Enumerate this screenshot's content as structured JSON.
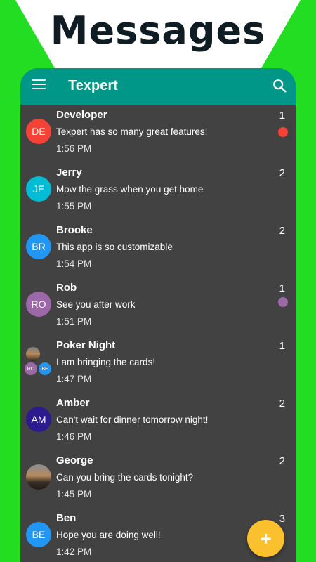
{
  "headline": "Messages",
  "colors": {
    "bg_green": "#22dd22",
    "appbar": "#009688",
    "list_bg": "#424242",
    "fab": "#fbc02d"
  },
  "appbar": {
    "title": "Texpert",
    "menu_icon": "hamburger-menu-icon",
    "search_icon": "search-icon"
  },
  "conversations": [
    {
      "name": "Developer",
      "preview": "Texpert has so many great features!",
      "time": "1:56 PM",
      "count": "1",
      "avatar_initials": "DE",
      "avatar_color": "#f44336",
      "unread_dot": "#f44336"
    },
    {
      "name": "Jerry",
      "preview": "Mow the grass when you get home",
      "time": "1:55 PM",
      "count": "2",
      "avatar_initials": "JE",
      "avatar_color": "#00bcd4"
    },
    {
      "name": "Brooke",
      "preview": "This app is so customizable",
      "time": "1:54 PM",
      "count": "2",
      "avatar_initials": "BR",
      "avatar_color": "#2196f3"
    },
    {
      "name": "Rob",
      "preview": "See you after work",
      "time": "1:51 PM",
      "count": "1",
      "avatar_initials": "RO",
      "avatar_color": "#9c68a8",
      "unread_dot": "#9c68a8"
    },
    {
      "name": "Poker Night",
      "preview": "I am bringing the cards!",
      "time": "1:47 PM",
      "count": "1",
      "group_members": [
        {
          "initials": "RO",
          "color": "#9c68a8"
        },
        {
          "initials": "BE",
          "color": "#2196f3"
        }
      ]
    },
    {
      "name": "Amber",
      "preview": "Can't wait for dinner tomorrow night!",
      "time": "1:46 PM",
      "count": "2",
      "avatar_initials": "AM",
      "avatar_color": "#2b1b8e"
    },
    {
      "name": "George",
      "preview": "Can you bring the cards tonight?",
      "time": "1:45 PM",
      "count": "2",
      "avatar_photo": "landscape-photo"
    },
    {
      "name": "Ben",
      "preview": "Hope you are doing well!",
      "time": "1:42 PM",
      "count": "3",
      "avatar_initials": "BE",
      "avatar_color": "#2196f3"
    }
  ],
  "fab": {
    "label": "+",
    "icon": "plus-icon"
  }
}
